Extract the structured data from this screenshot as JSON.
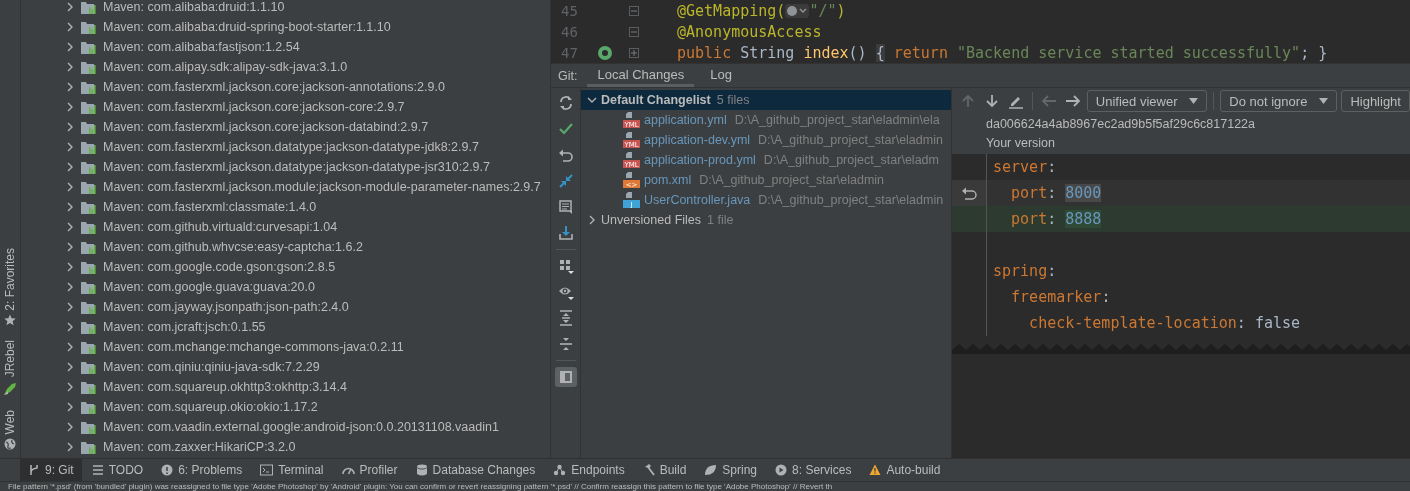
{
  "side_tabs": [
    {
      "label": "2: Favorites"
    },
    {
      "label": "JRebel"
    },
    {
      "label": "Web"
    }
  ],
  "project_tree": {
    "items": [
      {
        "label": "Maven: com.alibaba:druid:1.1.10",
        "expanded": false
      },
      {
        "label": "Maven: com.alibaba:druid-spring-boot-starter:1.1.10",
        "expanded": false
      },
      {
        "label": "Maven: com.alibaba:fastjson:1.2.54",
        "expanded": false
      },
      {
        "label": "Maven: com.alipay.sdk:alipay-sdk-java:3.1.0",
        "expanded": false
      },
      {
        "label": "Maven: com.fasterxml.jackson.core:jackson-annotations:2.9.0",
        "expanded": false
      },
      {
        "label": "Maven: com.fasterxml.jackson.core:jackson-core:2.9.7",
        "expanded": false
      },
      {
        "label": "Maven: com.fasterxml.jackson.core:jackson-databind:2.9.7",
        "expanded": false
      },
      {
        "label": "Maven: com.fasterxml.jackson.datatype:jackson-datatype-jdk8:2.9.7",
        "expanded": false
      },
      {
        "label": "Maven: com.fasterxml.jackson.datatype:jackson-datatype-jsr310:2.9.7",
        "expanded": false
      },
      {
        "label": "Maven: com.fasterxml.jackson.module:jackson-module-parameter-names:2.9.7",
        "expanded": false
      },
      {
        "label": "Maven: com.fasterxml:classmate:1.4.0",
        "expanded": false
      },
      {
        "label": "Maven: com.github.virtuald:curvesapi:1.04",
        "expanded": false
      },
      {
        "label": "Maven: com.github.whvcse:easy-captcha:1.6.2",
        "expanded": false
      },
      {
        "label": "Maven: com.google.code.gson:gson:2.8.5",
        "expanded": false
      },
      {
        "label": "Maven: com.google.guava:guava:20.0",
        "expanded": false
      },
      {
        "label": "Maven: com.jayway.jsonpath:json-path:2.4.0",
        "expanded": false
      },
      {
        "label": "Maven: com.jcraft:jsch:0.1.55",
        "expanded": false
      },
      {
        "label": "Maven: com.mchange:mchange-commons-java:0.2.11",
        "expanded": false
      },
      {
        "label": "Maven: com.qiniu:qiniu-java-sdk:7.2.29",
        "expanded": false
      },
      {
        "label": "Maven: com.squareup.okhttp3:okhttp:3.14.4",
        "expanded": false
      },
      {
        "label": "Maven: com.squareup.okio:okio:1.17.2",
        "expanded": false
      },
      {
        "label": "Maven: com.vaadin.external.google:android-json:0.0.20131108.vaadin1",
        "expanded": false
      },
      {
        "label": "Maven: com.zaxxer:HikariCP:3.2.0",
        "expanded": false
      }
    ]
  },
  "editor": {
    "lines": [
      {
        "number": "45",
        "collapsed": false,
        "run": false,
        "tokens": [
          {
            "text": "@GetMapping(",
            "kind": "annotation"
          },
          {
            "kind": "globe"
          },
          {
            "text": "\"/\"",
            "kind": "string"
          },
          {
            "text": ")",
            "kind": "annotation"
          }
        ]
      },
      {
        "number": "46",
        "collapsed": false,
        "run": false,
        "tokens": [
          {
            "text": "@AnonymousAccess",
            "kind": "annotation"
          }
        ]
      },
      {
        "number": "47",
        "collapsed": true,
        "run": true,
        "tokens": [
          {
            "text": "public ",
            "kind": "keyword"
          },
          {
            "text": "String ",
            "kind": "plain"
          },
          {
            "text": "index",
            "kind": "method"
          },
          {
            "text": "() ",
            "kind": "plain"
          },
          {
            "text": "{",
            "kind": "brace"
          },
          {
            "text": " return ",
            "kind": "keyword"
          },
          {
            "text": "\"Backend service started successfully\"",
            "kind": "string"
          },
          {
            "text": "; }",
            "kind": "plain"
          }
        ]
      }
    ]
  },
  "git_panel": {
    "title": "Git:",
    "tabs": [
      {
        "label": "Local Changes",
        "selected": true
      },
      {
        "label": "Log",
        "selected": false
      }
    ],
    "toolbar": [
      {
        "selected": false
      },
      {
        "selected": false
      },
      {
        "selected": false
      },
      {
        "selected": false
      },
      {
        "selected": false
      },
      {
        "selected": false
      },
      {
        "selected": false
      },
      {
        "selected": false
      },
      {
        "selected": false
      },
      {
        "selected": false
      },
      {
        "selected": true
      }
    ],
    "changelists": [
      {
        "name": "Default Changelist",
        "count": "5 files",
        "expanded": true,
        "selected": true,
        "files": [
          {
            "name": "application.yml",
            "path": "D:\\A_github_project_star\\eladmin\\ela",
            "kind": "yml",
            "badge": "YML"
          },
          {
            "name": "application-dev.yml",
            "path": "D:\\A_github_project_star\\eladmin",
            "kind": "yml",
            "badge": "YML"
          },
          {
            "name": "application-prod.yml",
            "path": "D:\\A_github_project_star\\eladm",
            "kind": "yml",
            "badge": "YML"
          },
          {
            "name": "pom.xml",
            "path": "D:\\A_github_project_star\\eladmin",
            "kind": "xml",
            "badge": "<>"
          },
          {
            "name": "UserController.java",
            "path": "D:\\A_github_project_star\\eladmin",
            "kind": "java",
            "badge": "J"
          }
        ]
      },
      {
        "name": "Unversioned Files",
        "count": "1 file",
        "expanded": false,
        "selected": false
      }
    ],
    "diff": {
      "nav": [
        {
          "disabled": true
        },
        {
          "disabled": false
        },
        {
          "disabled": false
        },
        {
          "disabled": true
        },
        {
          "disabled": false
        }
      ],
      "dropdowns": [
        {
          "label": "Unified viewer"
        },
        {
          "label": "Do not ignore"
        },
        {
          "label": "Highlight"
        }
      ],
      "revision": "da006624a4ab8967ec2ad9b5f5af29c6c817122a",
      "version_label": "Your version",
      "lines": [
        {
          "kind": "context",
          "tokens": [
            {
              "text": "server",
              "kind": "key"
            },
            {
              "text": ":",
              "kind": "punct"
            }
          ]
        },
        {
          "kind": "removed",
          "tokens": [
            {
              "text": "  port",
              "kind": "key"
            },
            {
              "text": ": ",
              "kind": "punct"
            },
            {
              "text": "8000",
              "kind": "changed"
            }
          ]
        },
        {
          "kind": "added",
          "tokens": [
            {
              "text": "  port",
              "kind": "key"
            },
            {
              "text": ": ",
              "kind": "punct"
            },
            {
              "text": "8888",
              "kind": "changed"
            }
          ]
        },
        {
          "kind": "context"
        },
        {
          "kind": "context",
          "tokens": [
            {
              "text": "spring",
              "kind": "key"
            },
            {
              "text": ":",
              "kind": "punct"
            }
          ]
        },
        {
          "kind": "context",
          "tokens": [
            {
              "text": "  freemarker",
              "kind": "key"
            },
            {
              "text": ":",
              "kind": "punct"
            }
          ]
        },
        {
          "kind": "context",
          "tokens": [
            {
              "text": "    check-template-location",
              "kind": "key"
            },
            {
              "text": ": ",
              "kind": "punct"
            },
            {
              "text": "false",
              "kind": "value"
            }
          ]
        }
      ]
    }
  },
  "tool_windows": [
    {
      "label": "9: Git",
      "selected": true
    },
    {
      "label": "TODO",
      "selected": false
    },
    {
      "label": "6: Problems",
      "selected": false
    },
    {
      "label": "Terminal",
      "selected": false
    },
    {
      "label": "Profiler",
      "selected": false
    },
    {
      "label": "Database Changes",
      "selected": false
    },
    {
      "label": "Endpoints",
      "selected": false
    },
    {
      "label": "Build",
      "selected": false
    },
    {
      "label": "Spring",
      "selected": false
    },
    {
      "label": "8: Services",
      "selected": false
    },
    {
      "label": "Auto-build",
      "selected": false
    }
  ],
  "status_bar": {
    "message": "File pattern '*.psd' (from 'bundled' plugin) was reassigned to file type 'Adobe Photoshop' by 'Android' plugin: You can confirm or revert reassigning pattern '*.psd' // Confirm reassign this pattern to file type 'Adobe Photoshop' // Revert th"
  }
}
